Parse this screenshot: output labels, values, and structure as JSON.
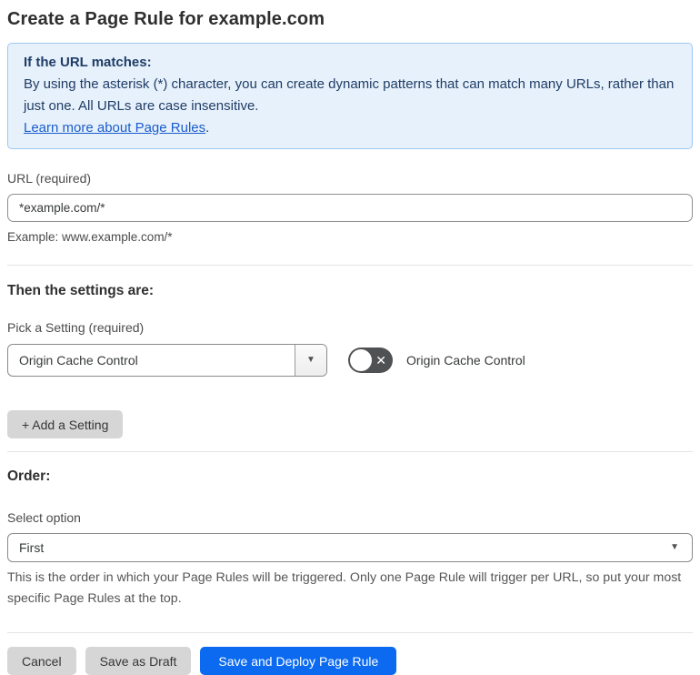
{
  "page_title": "Create a Page Rule for example.com",
  "info_box": {
    "heading": "If the URL matches:",
    "body": "By using the asterisk (*) character, you can create dynamic patterns that can match many URLs, rather than just one. All URLs are case insensitive.",
    "link_label": "Learn more about Page Rules",
    "link_suffix": "."
  },
  "url_field": {
    "label": "URL (required)",
    "value": "*example.com/*",
    "helper": "Example: www.example.com/*"
  },
  "settings_section": {
    "heading": "Then the settings are:",
    "pick_label": "Pick a Setting (required)",
    "selected_setting": "Origin Cache Control",
    "toggle_label": "Origin Cache Control",
    "toggle_state": "off",
    "add_setting_label": "+ Add a Setting"
  },
  "order_section": {
    "heading": "Order:",
    "select_label": "Select option",
    "selected_option": "First",
    "helper": "This is the order in which your Page Rules will be triggered. Only one Page Rule will trigger per URL, so put your most specific Page Rules at the top."
  },
  "footer": {
    "cancel_label": "Cancel",
    "save_draft_label": "Save as Draft",
    "save_deploy_label": "Save and Deploy Page Rule"
  },
  "icons": {
    "dropdown_arrow": "▼",
    "toggle_off_x": "✕"
  },
  "colors": {
    "accent_blue": "#0b6af0",
    "info_background": "#e7f1fb",
    "info_border": "#9ec9ef",
    "info_text": "#1f3d66",
    "link_blue": "#1b5dcc",
    "toggle_off_background": "#4f5152",
    "button_gray": "#d6d6d6"
  }
}
